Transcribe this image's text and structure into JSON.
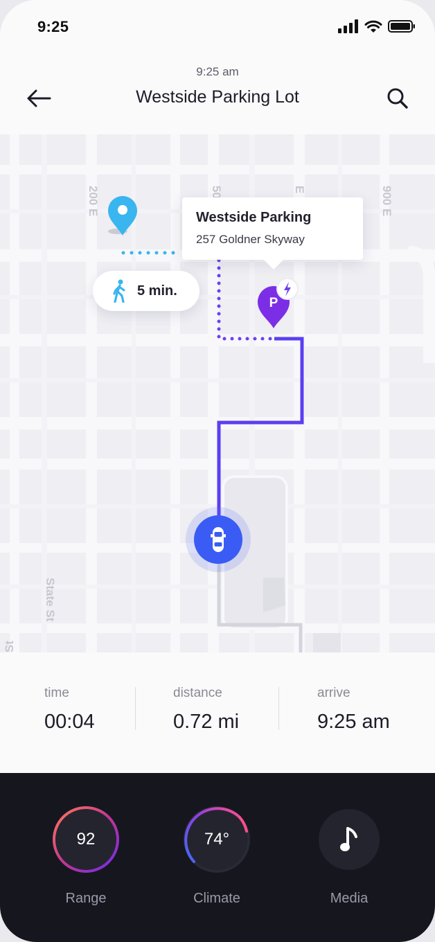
{
  "status_bar": {
    "time": "9:25"
  },
  "header": {
    "time": "9:25 am",
    "title": "Westside Parking Lot"
  },
  "map": {
    "street_labels": [
      "200 E",
      "500 E",
      "E",
      "900 E",
      "State St",
      "St"
    ],
    "callout": {
      "title": "Westside Parking",
      "address": "257 Goldner Skyway"
    },
    "walk_time": "5 min.",
    "parking_marker_letter": "P",
    "icons": [
      "location-pin-icon",
      "parking-pin-icon",
      "charging-bolt-icon",
      "walking-person-icon",
      "car-icon"
    ]
  },
  "trip": {
    "time": {
      "label": "time",
      "value": "00:04"
    },
    "distance": {
      "label": "distance",
      "value": "0.72 mi"
    },
    "arrive": {
      "label": "arrive",
      "value": "9:25 am"
    }
  },
  "controls": {
    "range": {
      "label": "Range",
      "value": "92"
    },
    "climate": {
      "label": "Climate",
      "value": "74°"
    },
    "media": {
      "label": "Media",
      "icon": "music-note-icon"
    }
  },
  "colors": {
    "route_purple": "#6d3ff0",
    "walk_blue": "#39b5ef",
    "car_blue": "#3a5cf5",
    "parking_purple": "#7b2ee6",
    "dark_panel": "#16161f"
  }
}
